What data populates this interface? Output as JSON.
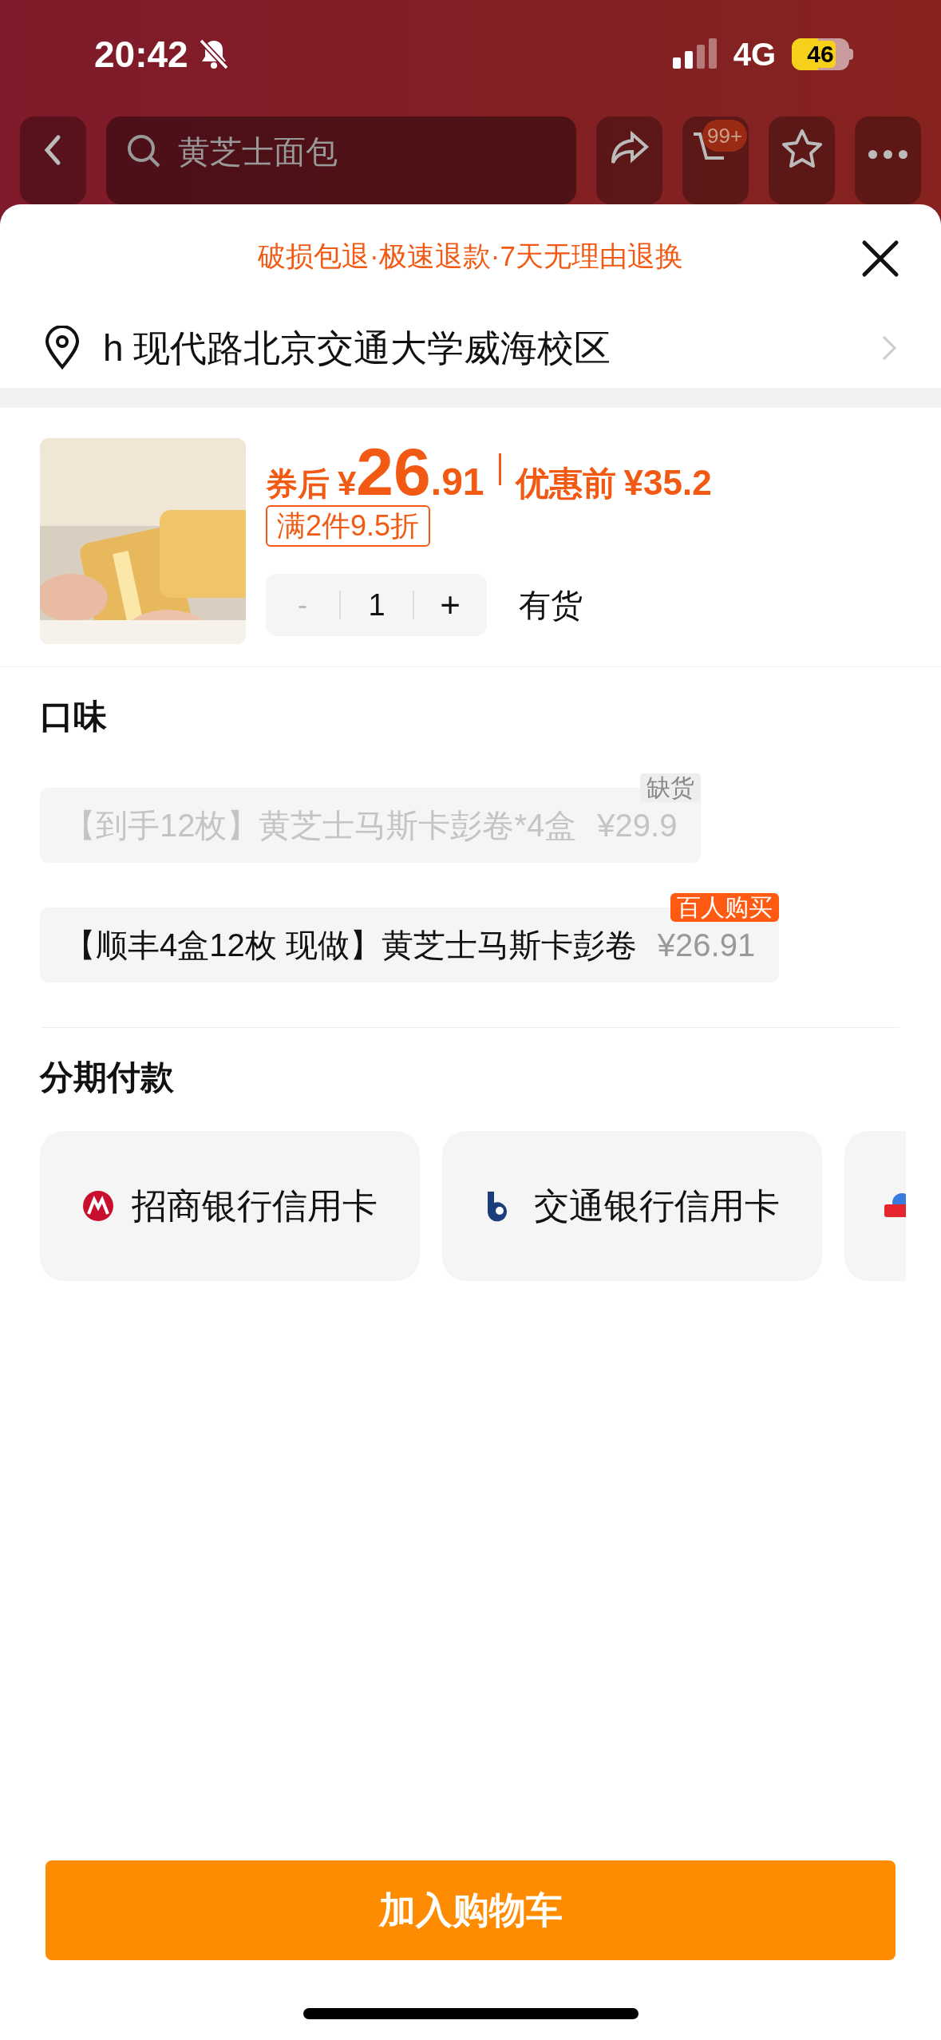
{
  "status_bar": {
    "time": "20:42",
    "network": "4G",
    "battery": "46"
  },
  "nav": {
    "search_placeholder": "黄芝士面包",
    "cart_badge": "99+"
  },
  "sheet": {
    "guarantee": "破损包退·极速退款·7天无理由退换",
    "address": "h 现代路北京交通大学威海校区",
    "product": {
      "price_prefix": "券后",
      "currency": "¥",
      "price_int": "26",
      "price_dec": ".91",
      "original_label": "优惠前",
      "original_price": "¥35.2",
      "promo": "满2件9.5折",
      "minus": "-",
      "minus_disabled": true,
      "quantity": "1",
      "plus": "+",
      "stock": "有货"
    },
    "flavor": {
      "title": "口味",
      "options": [
        {
          "label": "【到手12枚】黄芝士马斯卡彭卷*4盒",
          "price": "¥29.9",
          "badge": "缺货",
          "disabled": true
        },
        {
          "label": "【顺丰4盒12枚 现做】黄芝士马斯卡彭卷",
          "price": "¥26.91",
          "badge": "百人购买",
          "disabled": false
        }
      ]
    },
    "installments": {
      "title": "分期付款",
      "cards": [
        {
          "kind": "cmb",
          "name": "招商银行信用卡"
        },
        {
          "kind": "bocom",
          "name": "交通银行信用卡"
        },
        {
          "kind": "partial"
        }
      ]
    },
    "add_to_cart": "加入购物车"
  }
}
